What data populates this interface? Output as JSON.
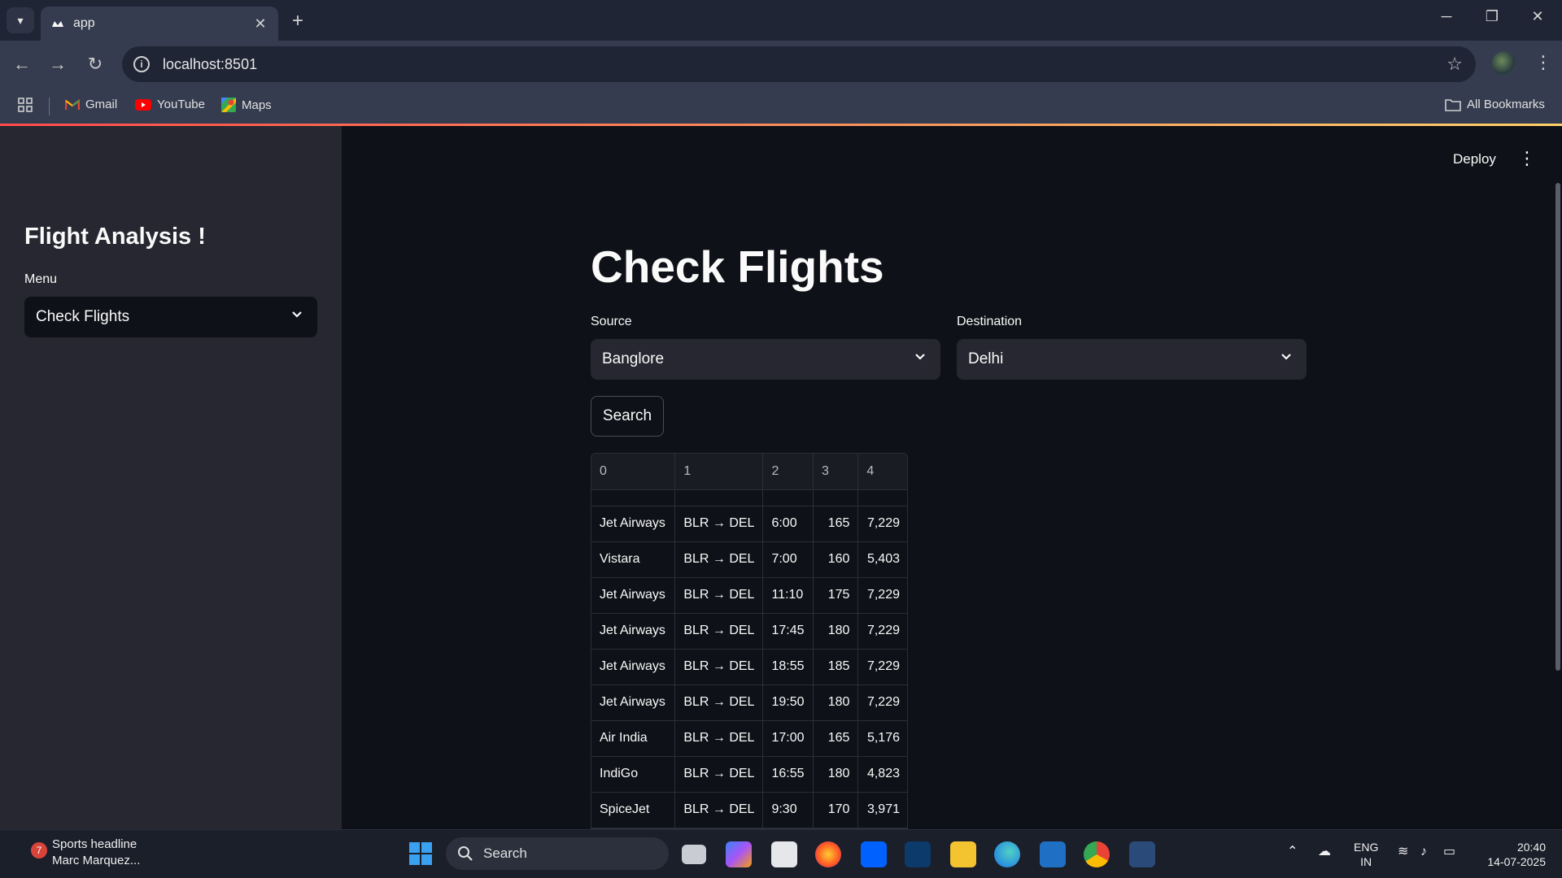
{
  "browser": {
    "tab_title": "app",
    "url": "localhost:8501",
    "bookmarks": [
      "Gmail",
      "YouTube",
      "Maps"
    ],
    "all_bookmarks": "All Bookmarks"
  },
  "sidebar": {
    "title": "Flight Analysis !",
    "menu_label": "Menu",
    "menu_value": "Check Flights"
  },
  "header": {
    "deploy": "Deploy"
  },
  "main": {
    "title": "Check Flights",
    "source_label": "Source",
    "source_value": "Banglore",
    "destination_label": "Destination",
    "destination_value": "Delhi",
    "search_button": "Search",
    "table": {
      "columns": [
        "0",
        "1",
        "2",
        "3",
        "4"
      ],
      "rows": [
        [
          "Jet Airways",
          "BLR → DEL",
          "6:00",
          "165",
          "7,229"
        ],
        [
          "Vistara",
          "BLR → DEL",
          "7:00",
          "160",
          "5,403"
        ],
        [
          "Jet Airways",
          "BLR → DEL",
          "11:10",
          "175",
          "7,229"
        ],
        [
          "Jet Airways",
          "BLR → DEL",
          "17:45",
          "180",
          "7,229"
        ],
        [
          "Jet Airways",
          "BLR → DEL",
          "18:55",
          "185",
          "7,229"
        ],
        [
          "Jet Airways",
          "BLR → DEL",
          "19:50",
          "180",
          "7,229"
        ],
        [
          "Air India",
          "BLR → DEL",
          "17:00",
          "165",
          "5,176"
        ],
        [
          "IndiGo",
          "BLR → DEL",
          "16:55",
          "180",
          "4,823"
        ],
        [
          "SpiceJet",
          "BLR → DEL",
          "9:30",
          "170",
          "3,971"
        ]
      ]
    }
  },
  "taskbar": {
    "news_count": "7",
    "news_title": "Sports headline",
    "news_sub": "Marc Marquez...",
    "search_placeholder": "Search",
    "lang_line1": "ENG",
    "lang_line2": "IN",
    "time": "20:40",
    "date": "14-07-2025"
  },
  "colors": {
    "sidebar_bg": "#262730",
    "main_bg": "#0e1117",
    "accent": "#ff4b4b"
  }
}
